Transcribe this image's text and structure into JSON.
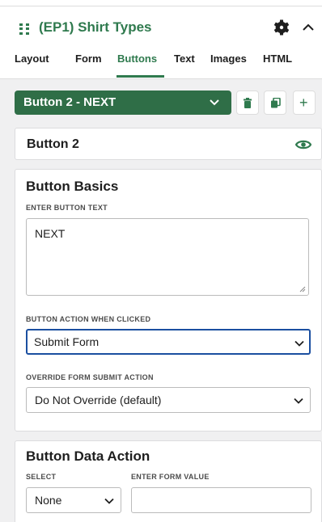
{
  "panel": {
    "title": "(EP1) Shirt Types",
    "icons": {
      "drag": "drag-grip-icon",
      "settings": "gear-icon",
      "collapse": "chevron-up-icon"
    }
  },
  "tabs": [
    {
      "label": "Layout"
    },
    {
      "label": "Form"
    },
    {
      "label": "Buttons",
      "active": true
    },
    {
      "label": "Text"
    },
    {
      "label": "Images"
    },
    {
      "label": "HTML"
    }
  ],
  "button_selector": {
    "selected": "Button 2 - NEXT",
    "actions": [
      "trash-icon",
      "duplicate-icon",
      "plus-icon"
    ],
    "add_label": "+"
  },
  "button_name": {
    "label": "Button 2",
    "visibility_icon": "eye-icon"
  },
  "basics": {
    "title": "Button Basics",
    "text_label": "ENTER BUTTON TEXT",
    "text_value": "NEXT",
    "action_label": "BUTTON ACTION WHEN CLICKED",
    "action_value": "Submit Form",
    "override_label": "OVERRIDE FORM SUBMIT ACTION",
    "override_value": "Do Not Override (default)"
  },
  "data_action": {
    "title": "Button Data Action",
    "select_label": "SELECT",
    "select_value": "None",
    "value_label": "ENTER FORM VALUE",
    "value_value": ""
  },
  "colors": {
    "brand_green": "#2f7a4e",
    "button_green": "#2f6e47",
    "focus_blue": "#1b4fa0"
  }
}
